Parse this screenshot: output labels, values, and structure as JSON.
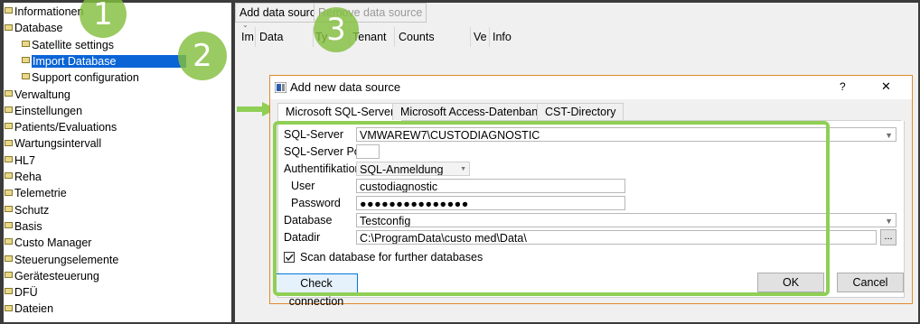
{
  "tree": {
    "items": [
      {
        "label": "Informationen",
        "level": 0
      },
      {
        "label": "Database",
        "level": 0
      },
      {
        "label": "Satellite settings",
        "level": 1
      },
      {
        "label": "Import Database",
        "level": 1,
        "selected": true
      },
      {
        "label": "Support configuration",
        "level": 1
      },
      {
        "label": "Verwaltung",
        "level": 0
      },
      {
        "label": "Einstellungen",
        "level": 0
      },
      {
        "label": "Patients/Evaluations",
        "level": 0
      },
      {
        "label": "Wartungsintervall",
        "level": 0
      },
      {
        "label": "HL7",
        "level": 0
      },
      {
        "label": "Reha",
        "level": 0
      },
      {
        "label": "Telemetrie",
        "level": 0
      },
      {
        "label": "Schutz",
        "level": 0
      },
      {
        "label": "Basis",
        "level": 0
      },
      {
        "label": "Custo Manager",
        "level": 0
      },
      {
        "label": "Steuerungselemente",
        "level": 0
      },
      {
        "label": "Gerätesteuerung",
        "level": 0
      },
      {
        "label": "DFÜ",
        "level": 0
      },
      {
        "label": "Dateien",
        "level": 0
      }
    ]
  },
  "toolbar": {
    "add_label": "Add data source",
    "remove_label": "Remove data source"
  },
  "columns": [
    "Im",
    "Data",
    "Ty",
    "Tenant",
    "Counts",
    "Ve",
    "Info"
  ],
  "dialog": {
    "title": "Add new data source",
    "help": "?",
    "close": "✕",
    "tabs": [
      "Microsoft SQL-Server",
      "Microsoft Access-Datenbank",
      "CST-Directory"
    ],
    "labels": {
      "sql_server": "SQL-Server",
      "sql_port": "SQL-Server Port",
      "auth": "Authentifikation",
      "user": "User",
      "password": "Password",
      "database": "Database",
      "datadir": "Datadir"
    },
    "values": {
      "sql_server": "VMWAREW7\\CUSTODIAGNOSTIC",
      "sql_port": "",
      "auth": "SQL-Anmeldung",
      "user": "custodiagnostic",
      "password": "●●●●●●●●●●●●●●●",
      "database": "Testconfig",
      "datadir": "C:\\ProgramData\\custo med\\Data\\"
    },
    "browse": "...",
    "scan_label": "Scan database for further databases",
    "scan_checked": true,
    "check_button": "Check connection",
    "ok_button": "OK",
    "cancel_button": "Cancel"
  },
  "badges": [
    "1",
    "2",
    "3"
  ],
  "colors": {
    "highlight": "#8fcf55",
    "selection": "#0a64d6",
    "badge": "#84be40",
    "dialog_border": "#e08a2c"
  }
}
